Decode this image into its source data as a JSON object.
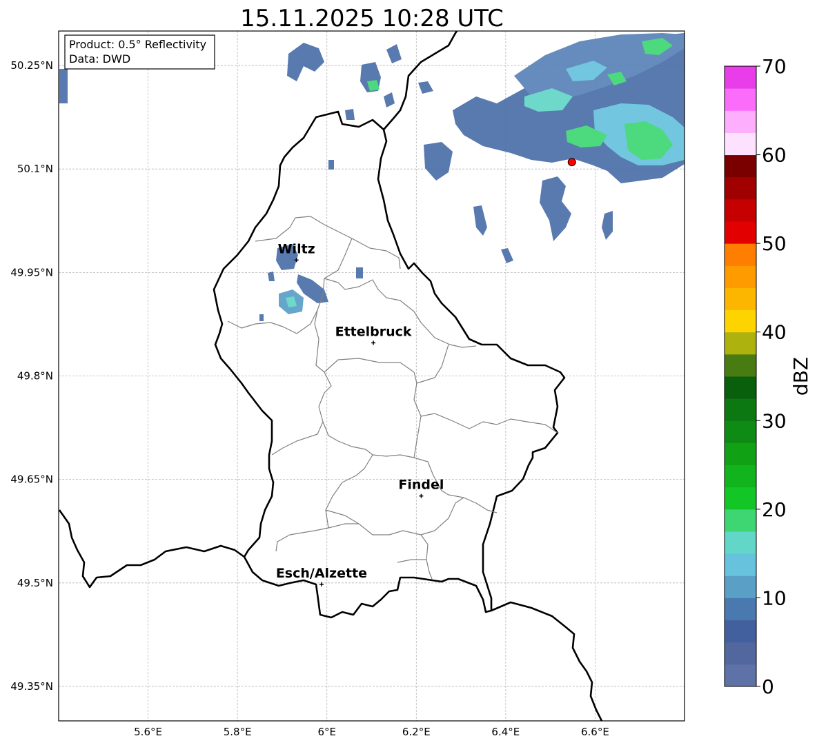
{
  "title": "15.11.2025 10:28 UTC",
  "info_box": {
    "product": "Product: 0.5° Reflectivity",
    "data": "Data: DWD"
  },
  "axes": {
    "lat_labels": [
      "50.25°N",
      "50.1°N",
      "49.95°N",
      "49.8°N",
      "49.65°N",
      "49.5°N",
      "49.35°N"
    ],
    "lon_labels": [
      "5.6°E",
      "5.8°E",
      "6°E",
      "6.2°E",
      "6.4°E",
      "6.6°E"
    ],
    "lat_values": [
      50.25,
      50.1,
      49.95,
      49.8,
      49.65,
      49.5,
      49.35
    ],
    "lon_values": [
      5.6,
      5.8,
      6.0,
      6.2,
      6.4,
      6.6
    ],
    "lat_range": [
      49.3,
      50.3
    ],
    "lon_range": [
      5.4,
      6.8
    ]
  },
  "cities": [
    {
      "name": "Wiltz",
      "lat": 49.968,
      "lon": 5.932
    },
    {
      "name": "Ettelbruck",
      "lat": 49.848,
      "lon": 6.104
    },
    {
      "name": "Findel",
      "lat": 49.626,
      "lon": 6.211
    },
    {
      "name": "Esch/Alzette",
      "lat": 49.498,
      "lon": 5.988
    }
  ],
  "radar_site": {
    "lat": 50.11,
    "lon": 6.548,
    "color": "#ff0000"
  },
  "colorbar": {
    "label": "dBZ",
    "tick_labels": [
      "70",
      "60",
      "50",
      "40",
      "30",
      "20",
      "10",
      "0"
    ],
    "min": 0,
    "max": 70,
    "step": 2.5,
    "colors": [
      "#5f72a8",
      "#52679e",
      "#43609e",
      "#4a79b0",
      "#599fc6",
      "#67c2dd",
      "#62d6c7",
      "#3ed672",
      "#12c725",
      "#12b41e",
      "#10a115",
      "#0e8b14",
      "#0b7811",
      "#095f0c",
      "#487b12",
      "#adb20e",
      "#fed400",
      "#fcb600",
      "#fe9b00",
      "#fd7e00",
      "#e20000",
      "#c60000",
      "#a00000",
      "#7a0000",
      "#fee1fe",
      "#fdaefd",
      "#fb6cfb",
      "#e93de9"
    ]
  }
}
